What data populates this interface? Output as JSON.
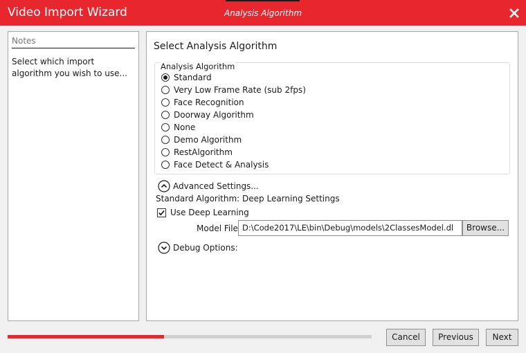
{
  "window": {
    "title": "Video Import Wizard",
    "subtitle": "Analysis Algorithm",
    "close_icon": "close-icon",
    "accent_color": "#e8262d"
  },
  "notes": {
    "header": "Notes",
    "text": "Select which import algorithm you wish to use..."
  },
  "main": {
    "heading": "Select Analysis Algorithm",
    "group_label": "Analysis Algorithm",
    "algorithms": [
      {
        "label": "Standard",
        "selected": true
      },
      {
        "label": "Very Low Frame Rate (sub 2fps)",
        "selected": false
      },
      {
        "label": "Face Recognition",
        "selected": false
      },
      {
        "label": "Doorway Algorithm",
        "selected": false
      },
      {
        "label": "None",
        "selected": false
      },
      {
        "label": "Demo Algorithm",
        "selected": false
      },
      {
        "label": "RestAlgorithm",
        "selected": false
      },
      {
        "label": "Face Detect & Analysis",
        "selected": false
      }
    ],
    "advanced": {
      "label": "Advanced Settings...",
      "icon": "chevron-up-icon",
      "settings_title": "Standard Algorithm: Deep Learning Settings",
      "use_deep_learning_label": "Use Deep Learning",
      "use_deep_learning_checked": true,
      "model_file_label": "Model File:",
      "model_file_value": "D:\\Code2017\\LE\\bin\\Debug\\models\\2ClassesModel.dl",
      "browse_label": "Browse..."
    },
    "debug": {
      "label": "Debug Options:",
      "icon": "chevron-down-icon"
    }
  },
  "footer": {
    "progress": 0.43,
    "cancel_label": "Cancel",
    "previous_label": "Previous",
    "next_label": "Next"
  }
}
